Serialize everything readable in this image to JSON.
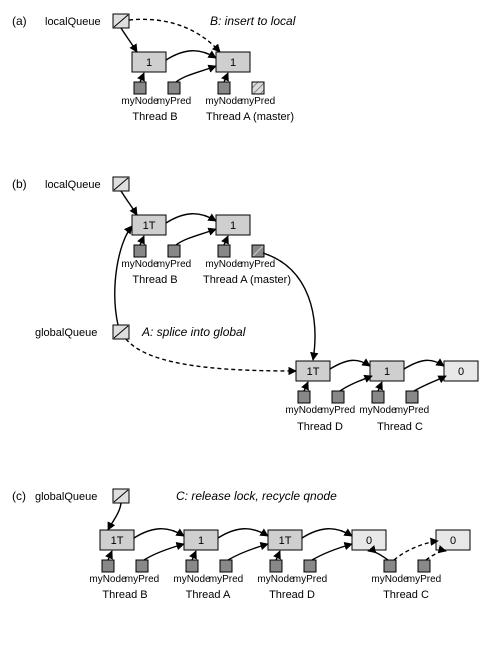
{
  "panels": {
    "a": {
      "letter": "(a)",
      "localQueue": "localQueue",
      "action": "B: insert to local",
      "nodes": {
        "nB": "1",
        "nA": "1"
      },
      "vars": [
        "myNode",
        "myPred",
        "myNode",
        "myPred"
      ],
      "threads": {
        "B": "Thread B",
        "A": "Thread A (master)"
      }
    },
    "b": {
      "letter": "(b)",
      "localQueue": "localQueue",
      "globalQueue": "globalQueue",
      "action": "A: splice into global",
      "nodes": {
        "nB": "1T",
        "nA": "1",
        "nD": "1T",
        "nDr": "1",
        "nC": "0"
      },
      "vars": [
        "myNode",
        "myPred",
        "myNode",
        "myPred",
        "myNode",
        "myPred",
        "myNode",
        "myPred"
      ],
      "threads": {
        "B": "Thread B",
        "A": "Thread A (master)",
        "D": "Thread D",
        "C": "Thread C"
      }
    },
    "c": {
      "letter": "(c)",
      "globalQueue": "globalQueue",
      "action": "C: release lock, recycle qnode",
      "nodes": {
        "nB": "1T",
        "nA": "1",
        "nD": "1T",
        "nDnext": "0",
        "nC": "0"
      },
      "vars": [
        "myNode",
        "myPred",
        "myNode",
        "myPred",
        "myNode",
        "myPred",
        "myNode",
        "myPred"
      ],
      "threads": {
        "B": "Thread B",
        "A": "Thread A",
        "D": "Thread D",
        "C": "Thread C"
      }
    }
  },
  "chart_data": [
    {
      "type": "diagram",
      "panel": "a",
      "title": "B: insert to local",
      "queues": {
        "localQueue": [
          "B.node(1)",
          "A.node(1)"
        ]
      },
      "threads": {
        "B": {
          "myNode": "B.node",
          "myPred": "A.node",
          "master": false
        },
        "A": {
          "myNode": "A.node",
          "myPred": null,
          "master": true
        }
      },
      "edges": [
        {
          "from": "localQueue.tail",
          "to": "B.node",
          "style": "solid"
        },
        {
          "from": "localQueue.tail(prev)",
          "to": "A.node",
          "style": "dashed",
          "note": "B insert"
        },
        {
          "from": "B.node.next",
          "to": "A.node",
          "style": "solid"
        }
      ]
    },
    {
      "type": "diagram",
      "panel": "b",
      "title": "A: splice into global",
      "queues": {
        "localQueue": [
          "B.node(1T)",
          "A.node(1)"
        ],
        "globalQueue": [
          "B.node(1T)",
          "...",
          "D.node(1T)",
          "next(1)",
          "C.node(0)"
        ]
      },
      "threads": {
        "B": {
          "myNode": "B.node",
          "myPred": "A.node",
          "master": false
        },
        "A": {
          "myNode": "A.node",
          "myPred": "D.node",
          "master": true
        },
        "D": {
          "myNode": "D.node",
          "myPred": "next(1)"
        },
        "C": {
          "myNode": "next(1)",
          "myPred": "C.node(0)"
        }
      },
      "edges": [
        {
          "from": "localQueue.tail",
          "to": "B.node",
          "style": "solid"
        },
        {
          "from": "B.node.next",
          "to": "A.node",
          "style": "solid"
        },
        {
          "from": "globalQueue.tail",
          "to": "B.node",
          "style": "solid"
        },
        {
          "from": "globalQueue.tail(prev)",
          "to": "D.node",
          "style": "dashed",
          "note": "A splice"
        },
        {
          "from": "A.myPred",
          "to": "D.node",
          "style": "solid"
        },
        {
          "from": "D.node.next",
          "to": "next(1)",
          "style": "solid"
        },
        {
          "from": "next(1).next",
          "to": "C.node(0)",
          "style": "solid"
        }
      ]
    },
    {
      "type": "diagram",
      "panel": "c",
      "title": "C: release lock, recycle qnode",
      "queues": {
        "globalQueue": [
          "B.node(1T)",
          "A.node(1)",
          "D.node(1T)",
          "node(0)",
          "C.recycled(0)"
        ]
      },
      "threads": {
        "B": {
          "myNode": "B.node",
          "myPred": "A.node"
        },
        "A": {
          "myNode": "A.node",
          "myPred": "D.node"
        },
        "D": {
          "myNode": "D.node",
          "myPred": "node(0)"
        },
        "C": {
          "myNode": "C.recycled",
          "myPred": "C.recycled"
        }
      },
      "edges": [
        {
          "from": "globalQueue.tail",
          "to": "B.node",
          "style": "solid"
        },
        {
          "from": "B.node.next",
          "to": "A.node",
          "style": "solid"
        },
        {
          "from": "A.node.next",
          "to": "D.node",
          "style": "solid"
        },
        {
          "from": "D.node.next",
          "to": "node(0)",
          "style": "solid"
        },
        {
          "from": "C.myNode",
          "to": "C.recycled",
          "style": "dashed"
        },
        {
          "from": "C.myPred",
          "to": "C.recycled",
          "style": "dashed"
        }
      ]
    }
  ]
}
